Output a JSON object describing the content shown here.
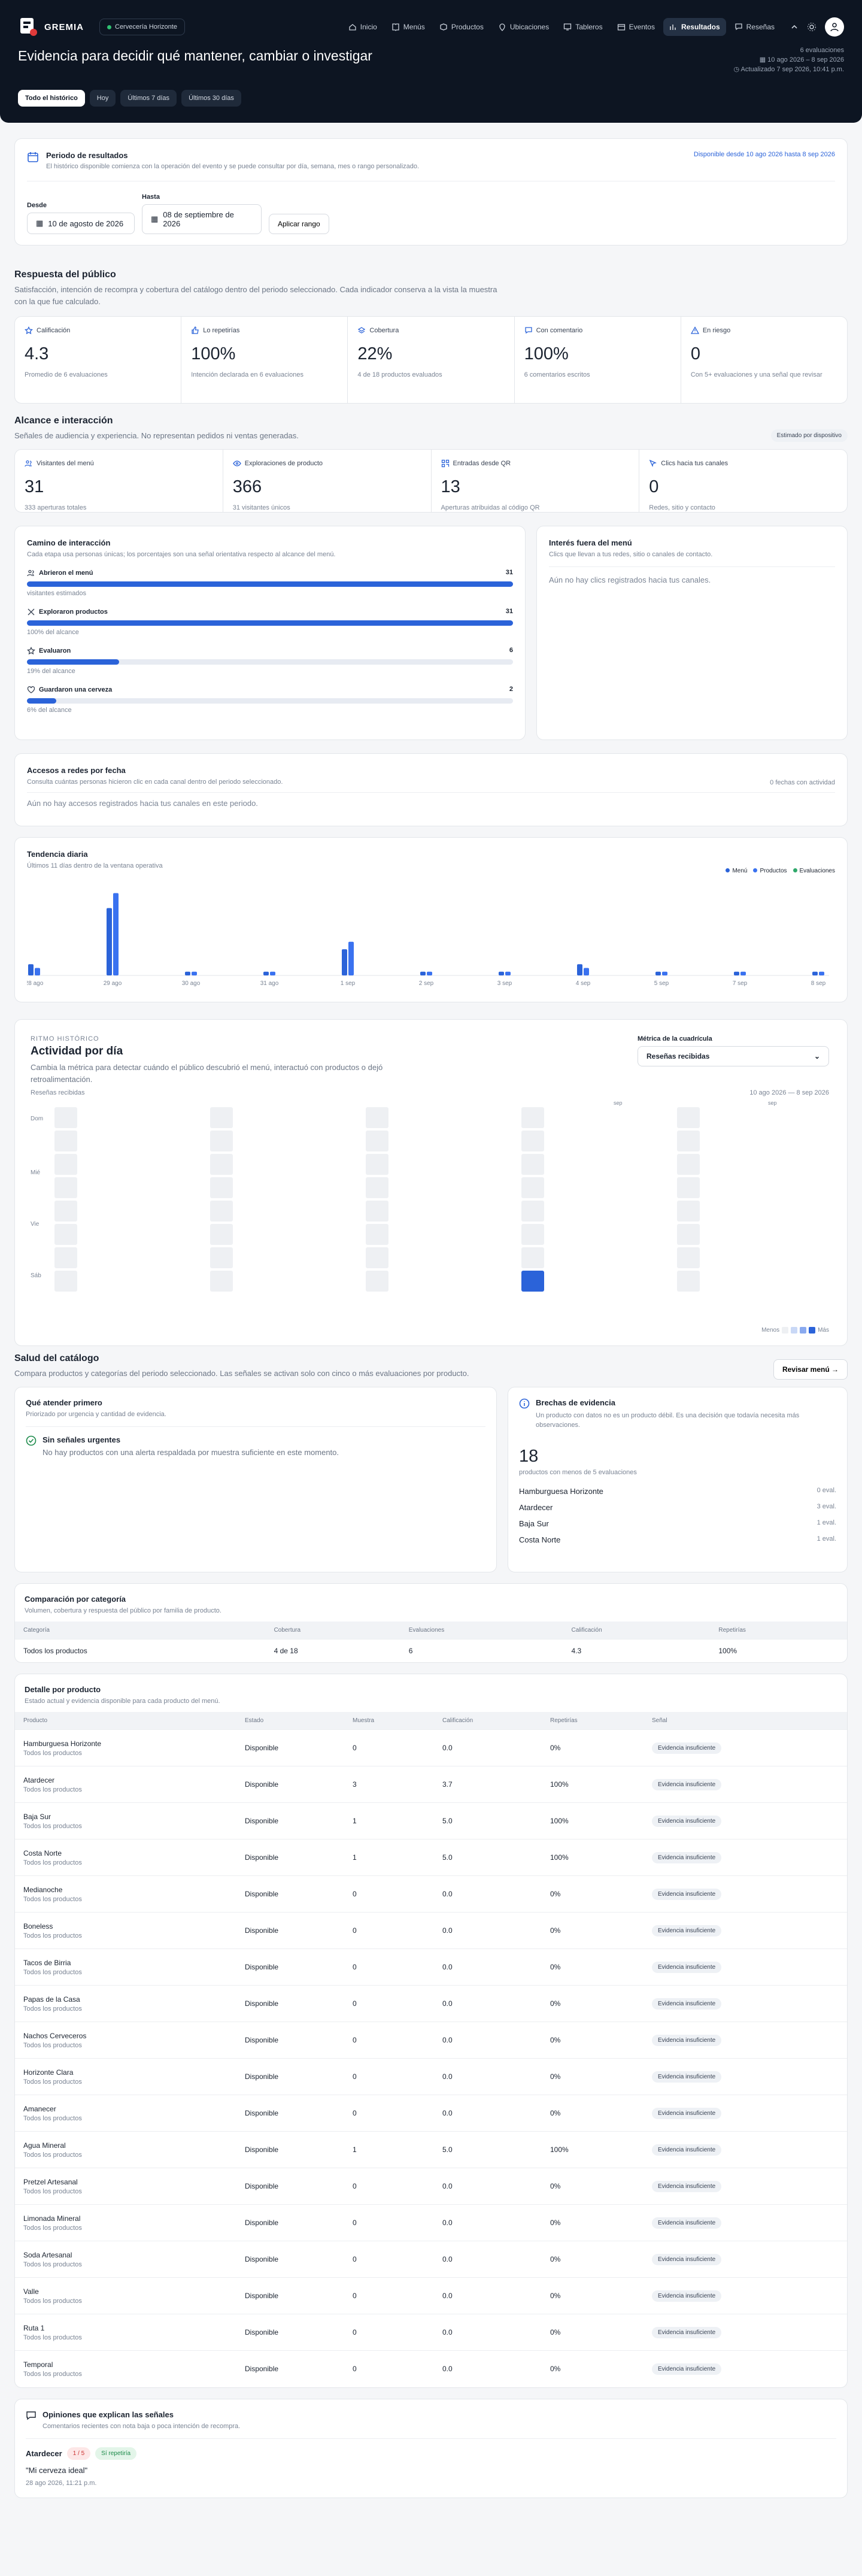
{
  "app": {
    "brand": "GREMIA",
    "venue": "Cervecería Horizonte"
  },
  "nav": [
    {
      "label": "Inicio",
      "icon": "home-icon"
    },
    {
      "label": "Menús",
      "icon": "book-icon"
    },
    {
      "label": "Productos",
      "icon": "box-icon"
    },
    {
      "label": "Ubicaciones",
      "icon": "pin-icon"
    },
    {
      "label": "Tableros",
      "icon": "monitor-icon"
    },
    {
      "label": "Eventos",
      "icon": "calendar-icon"
    },
    {
      "label": "Resultados",
      "icon": "chart-icon",
      "active": true
    },
    {
      "label": "Reseñas",
      "icon": "message-icon"
    }
  ],
  "hero": {
    "title": "Evidencia para decidir qué mantener, cambiar o investigar",
    "evaluations": "6 evaluaciones",
    "range": "10 ago 2026 – 8 sep 2026",
    "updated": "Actualizado 7 sep 2026, 10:41 p.m.",
    "tabs": [
      "Todo el histórico",
      "Hoy",
      "Últimos 7 días",
      "Últimos 30 días"
    ]
  },
  "period": {
    "title": "Periodo de resultados",
    "subtitle": "El histórico disponible comienza con la operación del evento y se puede consultar por día, semana, mes o rango personalizado.",
    "available": "Disponible desde 10 ago 2026 hasta 8 sep 2026",
    "from_label": "Desde",
    "from": "10 de agosto de 2026",
    "to_label": "Hasta",
    "to": "08 de septiembre de 2026",
    "apply": "Aplicar rango"
  },
  "response": {
    "title": "Respuesta del público",
    "subtitle": "Satisfacción, intención de recompra y cobertura del catálogo dentro del periodo seleccionado. Cada indicador conserva a la vista la muestra con la que fue calculado.",
    "kpis": [
      {
        "label": "Calificación",
        "value": "4.3",
        "sub": "Promedio de 6 evaluaciones",
        "icon": "star-icon"
      },
      {
        "label": "Lo repetirías",
        "value": "100%",
        "sub": "Intención declarada en 6 evaluaciones",
        "icon": "thumbs-up-icon"
      },
      {
        "label": "Cobertura",
        "value": "22%",
        "sub": "4 de 18 productos evaluados",
        "icon": "layers-icon"
      },
      {
        "label": "Con comentario",
        "value": "100%",
        "sub": "6 comentarios escritos",
        "icon": "comment-icon"
      },
      {
        "label": "En riesgo",
        "value": "0",
        "sub": "Con 5+ evaluaciones y una señal que revisar",
        "icon": "alert-icon"
      }
    ]
  },
  "reach": {
    "title": "Alcance e interacción",
    "subtitle": "Señales de audiencia y experiencia. No representan pedidos ni ventas generadas.",
    "badge": "Estimado por dispositivo",
    "kpis": [
      {
        "label": "Visitantes del menú",
        "value": "31",
        "sub": "333 aperturas totales",
        "icon": "users-icon"
      },
      {
        "label": "Exploraciones de producto",
        "value": "366",
        "sub": "31 visitantes únicos",
        "icon": "eye-icon"
      },
      {
        "label": "Entradas desde QR",
        "value": "13",
        "sub": "Aperturas atribuidas al código QR",
        "icon": "qr-icon"
      },
      {
        "label": "Clics hacia tus canales",
        "value": "0",
        "sub": "Redes, sitio y contacto",
        "icon": "cursor-icon"
      }
    ]
  },
  "funnel": {
    "title": "Camino de interacción",
    "subtitle": "Cada etapa usa personas únicas; los porcentajes son una señal orientativa respecto al alcance del menú.",
    "steps": [
      {
        "label": "Abrieron el menú",
        "count": "31",
        "note": "visitantes estimados",
        "pct": 1,
        "icon": "users-icon"
      },
      {
        "label": "Exploraron productos",
        "count": "31",
        "note": "100% del alcance",
        "pct": 1,
        "icon": "expand-icon"
      },
      {
        "label": "Evaluaron",
        "count": "6",
        "note": "19% del alcance",
        "pct": 0.19,
        "icon": "star-icon"
      },
      {
        "label": "Guardaron una cerveza",
        "count": "2",
        "note": "6% del alcance",
        "pct": 0.06,
        "icon": "heart-icon"
      }
    ]
  },
  "outside": {
    "title": "Interés fuera del menú",
    "subtitle": "Clics que llevan a tus redes, sitio o canales de contacto.",
    "empty": "Aún no hay clics registrados hacia tus canales."
  },
  "access": {
    "title": "Accesos a redes por fecha",
    "subtitle": "Consulta cuántas personas hicieron clic en cada canal dentro del periodo seleccionado.",
    "count": "0 fechas con actividad",
    "empty": "Aún no hay accesos registrados hacia tus canales en este periodo."
  },
  "trend": {
    "title": "Tendencia diaria",
    "subtitle": "Últimos 11 días dentro de la ventana operativa",
    "legend": [
      {
        "label": "Menú",
        "color": "#2b63d9"
      },
      {
        "label": "Productos",
        "color": "#3a72f0"
      },
      {
        "label": "Evaluaciones",
        "color": "#2fa96b"
      }
    ]
  },
  "chart_data": {
    "type": "bar",
    "categories": [
      "28 ago",
      "29 ago",
      "30 ago",
      "31 ago",
      "1 sep",
      "2 sep",
      "3 sep",
      "4 sep",
      "5 sep",
      "7 sep",
      "8 sep"
    ],
    "series": [
      {
        "name": "Menú",
        "values": [
          3,
          18,
          1,
          1,
          7,
          1,
          1,
          3,
          1,
          1,
          1
        ]
      },
      {
        "name": "Productos",
        "values": [
          2,
          22,
          1,
          1,
          9,
          1,
          1,
          2,
          1,
          1,
          1
        ]
      },
      {
        "name": "Evaluaciones",
        "values": [
          0,
          0,
          0,
          0,
          0,
          0,
          0,
          0,
          0,
          0,
          0
        ]
      }
    ],
    "ylim": [
      0,
      24
    ]
  },
  "heatmap": {
    "eyebrow": "RITMO HISTÓRICO",
    "title": "Actividad por día",
    "subtitle": "Cambia la métrica para detectar cuándo el público descubrió el menú, interactuó con productos o dejó retroalimentación.",
    "metric_label": "Métrica de la cuadrícula",
    "metric": "Reseñas recibidas",
    "caption": "Reseñas recibidas",
    "range": "10 ago 2026 — 8 sep 2026",
    "rows": [
      "Dom",
      "Mié",
      "Vie",
      "Sáb"
    ],
    "months": [
      "sep",
      "sep"
    ],
    "legend_less": "Menos",
    "legend_more": "Más",
    "active": {
      "week": 5,
      "day": 7,
      "value": 3
    }
  },
  "catalog": {
    "title": "Salud del catálogo",
    "subtitle": "Compara productos y categorías del periodo seleccionado. Las señales se activan solo con cinco o más evaluaciones por producto.",
    "action": "Revisar menú"
  },
  "first": {
    "title": "Qué atender primero",
    "subtitle": "Priorizado por urgencia y cantidad de evidencia.",
    "empty_title": "Sin señales urgentes",
    "empty_sub": "No hay productos con una alerta respaldada por muestra suficiente en este momento."
  },
  "gaps": {
    "title": "Brechas de evidencia",
    "subtitle": "Un producto con datos no es un producto débil. Es una decisión que todavía necesita más observaciones.",
    "value": "18",
    "value_sub": "productos con menos de 5 evaluaciones",
    "items": [
      {
        "name": "Hamburguesa Horizonte",
        "count": "0 eval."
      },
      {
        "name": "Atardecer",
        "count": "3 eval."
      },
      {
        "name": "Baja Sur",
        "count": "1 eval."
      },
      {
        "name": "Costa Norte",
        "count": "1 eval."
      }
    ]
  },
  "category": {
    "title": "Comparación por categoría",
    "subtitle": "Volumen, cobertura y respuesta del público por familia de producto.",
    "headers": [
      "Categoría",
      "Cobertura",
      "Evaluaciones",
      "Calificación",
      "Repetirías"
    ],
    "rows": [
      [
        "Todos los productos",
        "4 de 18",
        "6",
        "4.3",
        "100%"
      ]
    ]
  },
  "detail": {
    "title": "Detalle por producto",
    "subtitle": "Estado actual y evidencia disponible para cada producto del menú.",
    "headers": [
      "Producto",
      "Estado",
      "Muestra",
      "Calificación",
      "Repetirías",
      "Señal"
    ],
    "rows": [
      {
        "name": "Hamburguesa Horizonte",
        "cat": "Todos los productos",
        "state": "Disponible",
        "n": "0",
        "rating": "0.0",
        "rep": "0%",
        "signal": "Evidencia insuficiente"
      },
      {
        "name": "Atardecer",
        "cat": "Todos los productos",
        "state": "Disponible",
        "n": "3",
        "rating": "3.7",
        "rep": "100%",
        "signal": "Evidencia insuficiente"
      },
      {
        "name": "Baja Sur",
        "cat": "Todos los productos",
        "state": "Disponible",
        "n": "1",
        "rating": "5.0",
        "rep": "100%",
        "signal": "Evidencia insuficiente"
      },
      {
        "name": "Costa Norte",
        "cat": "Todos los productos",
        "state": "Disponible",
        "n": "1",
        "rating": "5.0",
        "rep": "100%",
        "signal": "Evidencia insuficiente"
      },
      {
        "name": "Medianoche",
        "cat": "Todos los productos",
        "state": "Disponible",
        "n": "0",
        "rating": "0.0",
        "rep": "0%",
        "signal": "Evidencia insuficiente"
      },
      {
        "name": "Boneless",
        "cat": "Todos los productos",
        "state": "Disponible",
        "n": "0",
        "rating": "0.0",
        "rep": "0%",
        "signal": "Evidencia insuficiente"
      },
      {
        "name": "Tacos de Birria",
        "cat": "Todos los productos",
        "state": "Disponible",
        "n": "0",
        "rating": "0.0",
        "rep": "0%",
        "signal": "Evidencia insuficiente"
      },
      {
        "name": "Papas de la Casa",
        "cat": "Todos los productos",
        "state": "Disponible",
        "n": "0",
        "rating": "0.0",
        "rep": "0%",
        "signal": "Evidencia insuficiente"
      },
      {
        "name": "Nachos Cerveceros",
        "cat": "Todos los productos",
        "state": "Disponible",
        "n": "0",
        "rating": "0.0",
        "rep": "0%",
        "signal": "Evidencia insuficiente"
      },
      {
        "name": "Horizonte Clara",
        "cat": "Todos los productos",
        "state": "Disponible",
        "n": "0",
        "rating": "0.0",
        "rep": "0%",
        "signal": "Evidencia insuficiente"
      },
      {
        "name": "Amanecer",
        "cat": "Todos los productos",
        "state": "Disponible",
        "n": "0",
        "rating": "0.0",
        "rep": "0%",
        "signal": "Evidencia insuficiente"
      },
      {
        "name": "Agua Mineral",
        "cat": "Todos los productos",
        "state": "Disponible",
        "n": "1",
        "rating": "5.0",
        "rep": "100%",
        "signal": "Evidencia insuficiente"
      },
      {
        "name": "Pretzel Artesanal",
        "cat": "Todos los productos",
        "state": "Disponible",
        "n": "0",
        "rating": "0.0",
        "rep": "0%",
        "signal": "Evidencia insuficiente"
      },
      {
        "name": "Limonada Mineral",
        "cat": "Todos los productos",
        "state": "Disponible",
        "n": "0",
        "rating": "0.0",
        "rep": "0%",
        "signal": "Evidencia insuficiente"
      },
      {
        "name": "Soda Artesanal",
        "cat": "Todos los productos",
        "state": "Disponible",
        "n": "0",
        "rating": "0.0",
        "rep": "0%",
        "signal": "Evidencia insuficiente"
      },
      {
        "name": "Valle",
        "cat": "Todos los productos",
        "state": "Disponible",
        "n": "0",
        "rating": "0.0",
        "rep": "0%",
        "signal": "Evidencia insuficiente"
      },
      {
        "name": "Ruta 1",
        "cat": "Todos los productos",
        "state": "Disponible",
        "n": "0",
        "rating": "0.0",
        "rep": "0%",
        "signal": "Evidencia insuficiente"
      },
      {
        "name": "Temporal",
        "cat": "Todos los productos",
        "state": "Disponible",
        "n": "0",
        "rating": "0.0",
        "rep": "0%",
        "signal": "Evidencia insuficiente"
      }
    ]
  },
  "opinions": {
    "title": "Opiniones que explican las señales",
    "subtitle": "Comentarios recientes con nota baja o poca intención de recompra.",
    "item": {
      "product": "Atardecer",
      "score": "1 / 5",
      "badge": "Sí repetiría",
      "quote": "\"Mi cerveza ideal\"",
      "date": "28 ago 2026, 11:21 p.m."
    }
  },
  "colors": {
    "accent": "#2b63d9",
    "hero": "#0d1522"
  }
}
